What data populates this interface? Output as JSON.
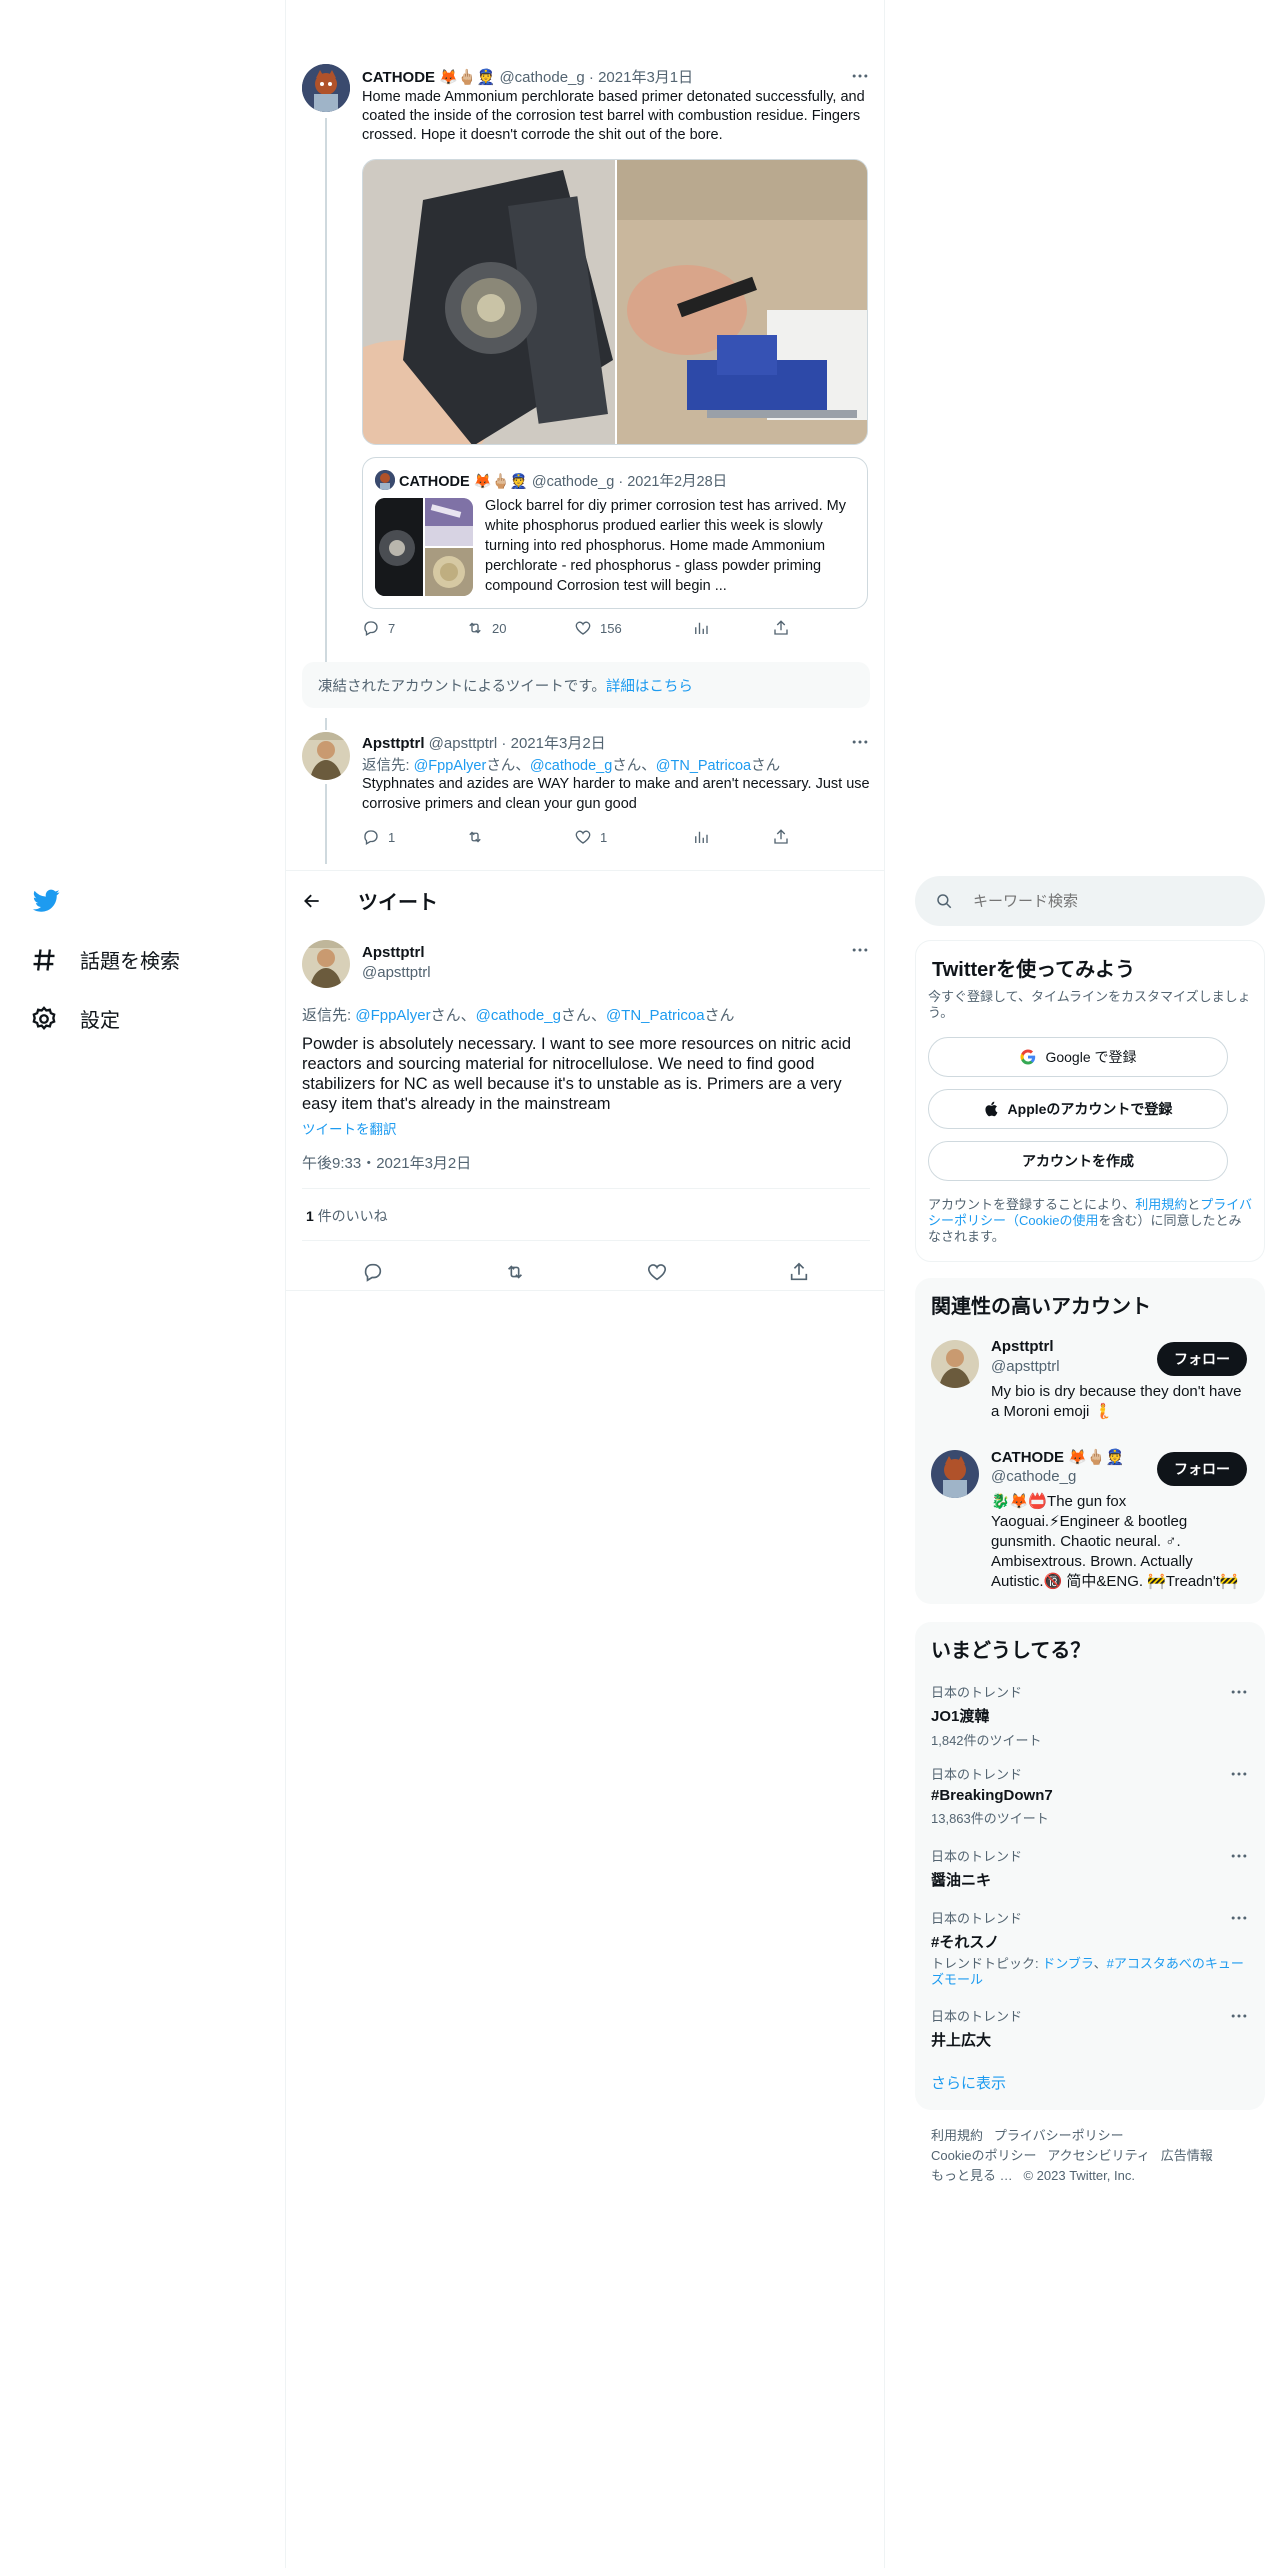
{
  "nav": {
    "explore_label": "話題を検索",
    "settings_label": "設定"
  },
  "thread": {
    "tweet1": {
      "author": "CATHODE",
      "author_emoji": "🦊🖕🏼👮",
      "handle": "@cathode_g",
      "date": "2021年3月1日",
      "text": "Home made Ammonium perchlorate based primer detonated successfully, and coated the inside of the corrosion test barrel with combustion residue. Fingers crossed. Hope it doesn't corrode the shit out of the bore.",
      "quote": {
        "author": "CATHODE",
        "author_emoji": "🦊🖕🏼👮",
        "handle": "@cathode_g",
        "date": "2021年2月28日",
        "text": "Glock barrel for diy primer corrosion test has arrived. My white phosphorus produed earlier this week is slowly turning into red phosphorus. Home made Ammonium perchlorate - red phosphorus - glass powder priming compound Corrosion test will begin ..."
      },
      "replies": "7",
      "retweets": "20",
      "likes": "156"
    },
    "suspended_notice": "凍結されたアカウントによるツイートです。",
    "suspended_link": "詳細はこちら",
    "tweet2": {
      "author": "Apsttptrl",
      "handle": "@apsttptrl",
      "date": "2021年3月2日",
      "reply_prefix": "返信先: ",
      "reply_to_1": "@FppAlyer",
      "reply_to_2": "@cathode_g",
      "reply_to_3": "@TN_Patricoa",
      "san": "さん",
      "sep": "、",
      "text": "Styphnates and azides are WAY harder to make and aren't necessary. Just use corrosive primers and clean your gun good",
      "replies": "1",
      "likes": "1"
    }
  },
  "header": {
    "title": "ツイート"
  },
  "focused": {
    "author": "Apsttptrl",
    "handle": "@apsttptrl",
    "reply_prefix": "返信先: ",
    "reply_to_1": "@FppAlyer",
    "reply_to_2": "@cathode_g",
    "reply_to_3": "@TN_Patricoa",
    "san": "さん",
    "sep": "、",
    "text": "Powder is absolutely necessary. I want to see more resources on nitric acid reactors and sourcing material for nitrocellulose. We need to find good stabilizers for NC as well because it's to unstable as is. Primers are a very easy item that's already in the mainstream",
    "translate": "ツイートを翻訳",
    "timestamp": "午後9:33・2021年3月2日",
    "likes_count": "1",
    "likes_label": "件のいいね"
  },
  "search": {
    "placeholder": "キーワード検索"
  },
  "signup": {
    "title": "Twitterを使ってみよう",
    "subtitle": "今すぐ登録して、タイムラインをカスタマイズしましょう。",
    "google_btn": "Google で登録",
    "apple_btn": "Appleのアカウントで登録",
    "create_btn": "アカウントを作成",
    "legal_1": "アカウントを登録することにより、",
    "legal_terms": "利用規約",
    "legal_2": "と",
    "legal_privacy": "プライバシーポリシー（Cookieの使用",
    "legal_3": "を含む）に同意したとみなされます。"
  },
  "related": {
    "title": "関連性の高いアカウント",
    "follow_label": "フォロー",
    "accounts": [
      {
        "name": "Apsttptrl",
        "handle": "@apsttptrl",
        "bio": "My bio is dry because they don't have a Moroni emoji 🧜"
      },
      {
        "name": "CATHODE",
        "name_emoji": "🦊🖕🏼👮",
        "handle": "@cathode_g",
        "bio": "🐉🦊📛The gun fox Yaoguai.⚡Engineer & bootleg gunsmith. Chaotic neural. ♂. Ambisextrous. Brown. Actually Autistic.🔞 简中&ENG. 🚧Treadn't🚧"
      }
    ]
  },
  "trends": {
    "title": "いまどうしてる？",
    "items": [
      {
        "category": "日本のトレンド",
        "name": "JO1渡韓",
        "count": "1,842件のツイート"
      },
      {
        "category": "日本のトレンド",
        "name": "#BreakingDown7",
        "count": "13,863件のツイート"
      },
      {
        "category": "日本のトレンド",
        "name": "醤油ニキ",
        "count": ""
      },
      {
        "category": "日本のトレンド",
        "name": "#それスノ",
        "topic_prefix": "トレンドトピック: ",
        "topic_1": "ドンブラ",
        "topic_sep": "、",
        "topic_2": "#アコスタあべのキューズモール"
      },
      {
        "category": "日本のトレンド",
        "name": "井上広大",
        "count": ""
      }
    ],
    "show_more": "さらに表示"
  },
  "footer": {
    "terms": "利用規約",
    "privacy": "プライバシーポリシー",
    "cookie": "Cookieのポリシー",
    "accessibility": "アクセシビリティ",
    "ads": "広告情報",
    "more": "もっと見る …",
    "copyright": "© 2023 Twitter, Inc."
  },
  "colors": {
    "accent": "#1d9bf0",
    "text": "#0f1419",
    "muted": "#536471",
    "panel": "#f7f9f9"
  }
}
